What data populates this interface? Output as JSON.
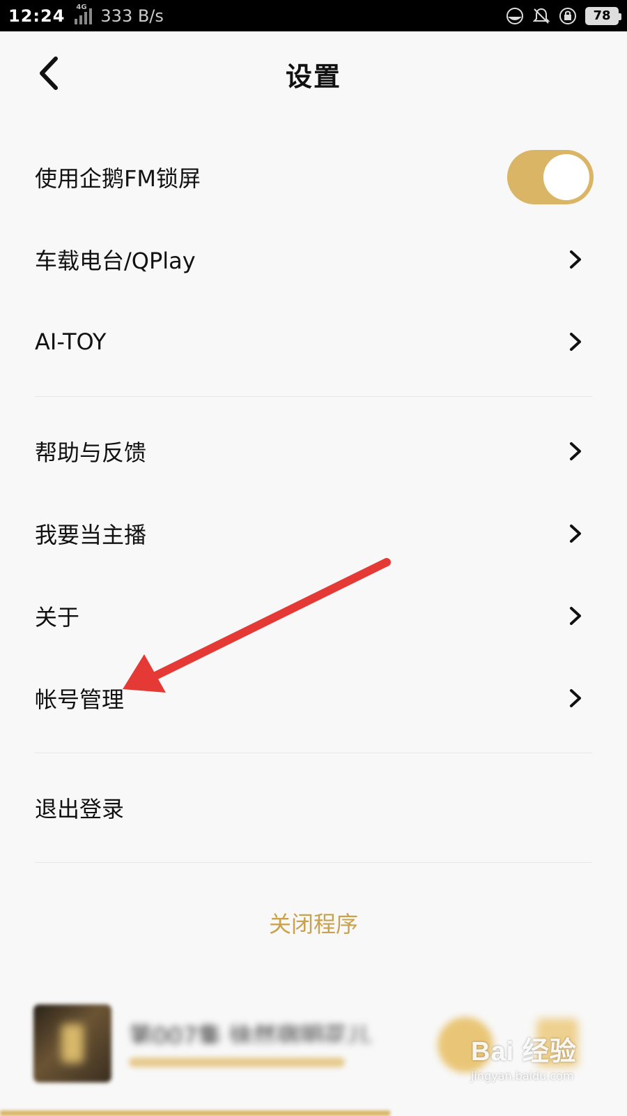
{
  "status_bar": {
    "time": "12:24",
    "network_type": "4G",
    "net_speed": "333 B/s",
    "battery": "78",
    "icons": [
      "signal-icon",
      "eye-comfort-icon",
      "alarm-off-icon",
      "rotation-lock-icon",
      "battery-icon"
    ]
  },
  "header": {
    "title": "设置",
    "back_icon": "chevron-left-icon"
  },
  "settings": {
    "lock_screen": {
      "label": "使用企鹅FM锁屏",
      "enabled": true
    },
    "items_group1": [
      {
        "label": "车载电台/QPlay"
      },
      {
        "label": "AI-TOY"
      }
    ],
    "items_group2": [
      {
        "label": "帮助与反馈"
      },
      {
        "label": "我要当主播"
      },
      {
        "label": "关于"
      },
      {
        "label": "帐号管理"
      }
    ],
    "logout": {
      "label": "退出登录"
    }
  },
  "close_app": {
    "label": "关闭程序"
  },
  "mini_player": {
    "title_blurred": "第007集 徐然宿明花儿"
  },
  "watermark": {
    "main": "Bai 经验",
    "sub": "jingyan.baidu.com"
  },
  "colors": {
    "accent": "#d9b565",
    "close_text": "#c9a24f",
    "annotation_arrow": "#e53935",
    "background": "#f8f8f8"
  }
}
